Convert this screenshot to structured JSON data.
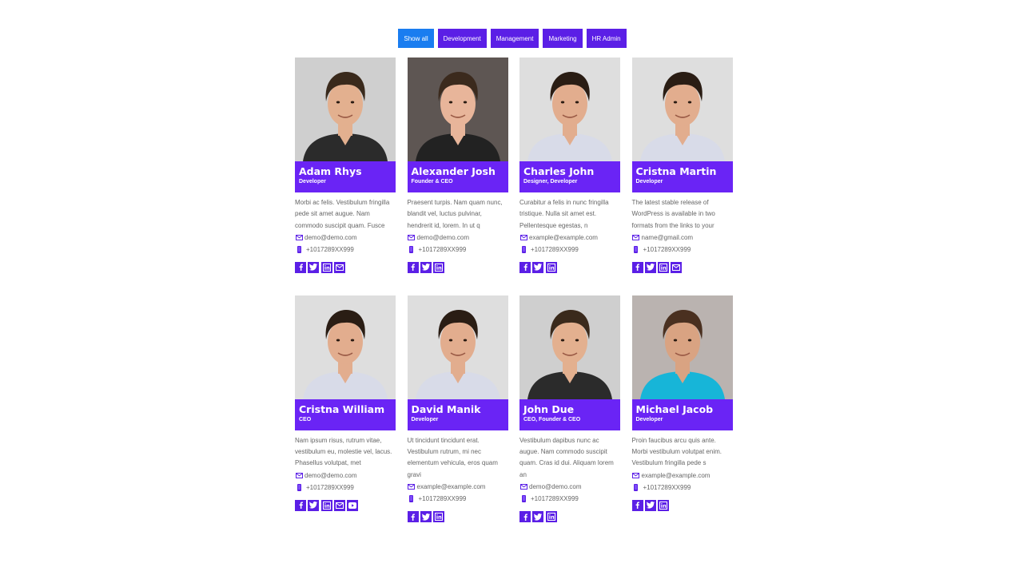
{
  "filters": [
    {
      "label": "Show all",
      "active": true
    },
    {
      "label": "Development",
      "active": false
    },
    {
      "label": "Management",
      "active": false
    },
    {
      "label": "Marketing",
      "active": false
    },
    {
      "label": "HR Admin",
      "active": false
    }
  ],
  "colors": {
    "accent": "#6a24f5",
    "button": "#5b1fe6",
    "active_button": "#1a7df0"
  },
  "members": [
    {
      "name": "Adam Rhys",
      "role": "Developer",
      "bio": "Morbi ac felis. Vestibulum fringilla pede sit amet augue. Nam commodo suscipit quam. Fusce",
      "email": "demo@demo.com",
      "phone": "+1017289XX999",
      "socials": [
        "facebook-icon",
        "twitter-icon",
        "linkedin-icon",
        "mail-icon"
      ],
      "photo": {
        "bg": "#cfcfcf",
        "shirt": "#2b2b2b",
        "hair": "#3a2a1c",
        "skin": "#e3b08f"
      }
    },
    {
      "name": "Alexander Josh",
      "role": "Founder & CEO",
      "bio": "Praesent turpis. Nam quam nunc, blandit vel, luctus pulvinar, hendrerit id, lorem. In ut q",
      "email": "demo@demo.com",
      "phone": "+1017289XX999",
      "socials": [
        "facebook-icon",
        "twitter-icon",
        "linkedin-icon"
      ],
      "photo": {
        "bg": "#5e5653",
        "shirt": "#222222",
        "hair": "#3b2a1d",
        "skin": "#e8b59a"
      }
    },
    {
      "name": "Charles John",
      "role": "Designer, Developer",
      "bio": "Curabitur a felis in nunc fringilla tristique. Nulla sit amet est. Pellentesque egestas, n",
      "email": "example@example.com",
      "phone": "+1017289XX999",
      "socials": [
        "facebook-icon",
        "twitter-icon",
        "linkedin-icon"
      ],
      "photo": {
        "bg": "#dedede",
        "shirt": "#d8dbe8",
        "hair": "#2a1d14",
        "skin": "#e2ad8e"
      }
    },
    {
      "name": "Cristna Martin",
      "role": "Developer",
      "bio": "The latest stable release of WordPress is available in two formats from the links to your",
      "email": "name@gmail.com",
      "phone": "+1017289XX999",
      "socials": [
        "facebook-icon",
        "twitter-icon",
        "linkedin-icon",
        "mail-icon"
      ],
      "photo": {
        "bg": "#dedede",
        "shirt": "#d8dbe8",
        "hair": "#2a1d14",
        "skin": "#e2ad8e"
      }
    },
    {
      "name": "Cristna William",
      "role": "CEO",
      "bio": "Nam ipsum risus, rutrum vitae, vestibulum eu, molestie vel, lacus. Phasellus volutpat, met",
      "email": "demo@demo.com",
      "phone": "+1017289XX999",
      "socials": [
        "facebook-icon",
        "twitter-icon",
        "linkedin-icon",
        "mail-icon",
        "youtube-icon"
      ],
      "photo": {
        "bg": "#dedede",
        "shirt": "#d8dbe8",
        "hair": "#2a1d14",
        "skin": "#e2ad8e"
      }
    },
    {
      "name": "David Manik",
      "role": "Developer",
      "bio": "Ut tincidunt tincidunt erat. Vestibulum rutrum, mi nec elementum vehicula, eros quam gravi",
      "email": "example@example.com",
      "phone": "+1017289XX999",
      "socials": [
        "facebook-icon",
        "twitter-icon",
        "linkedin-icon"
      ],
      "photo": {
        "bg": "#dedede",
        "shirt": "#d8dbe8",
        "hair": "#2a1d14",
        "skin": "#e2ad8e"
      }
    },
    {
      "name": "John Due",
      "role": "CEO, Founder & CEO",
      "bio": "Vestibulum dapibus nunc ac augue. Nam commodo suscipit quam. Cras id dui. Aliquam lorem an",
      "email": "demo@demo.com",
      "phone": "+1017289XX999",
      "socials": [
        "facebook-icon",
        "twitter-icon",
        "linkedin-icon"
      ],
      "photo": {
        "bg": "#cfcfcf",
        "shirt": "#2b2b2b",
        "hair": "#3a2a1c",
        "skin": "#e3b08f"
      }
    },
    {
      "name": "Michael Jacob",
      "role": "Developer",
      "bio": "Proin faucibus arcu quis ante. Morbi vestibulum volutpat enim. Vestibulum fringilla pede s",
      "email": "example@example.com",
      "phone": "+1017289XX999",
      "socials": [
        "facebook-icon",
        "twitter-icon",
        "linkedin-icon"
      ],
      "photo": {
        "bg": "#bab3b0",
        "shirt": "#17b5d8",
        "hair": "#4a3020",
        "skin": "#d9a382"
      }
    }
  ]
}
